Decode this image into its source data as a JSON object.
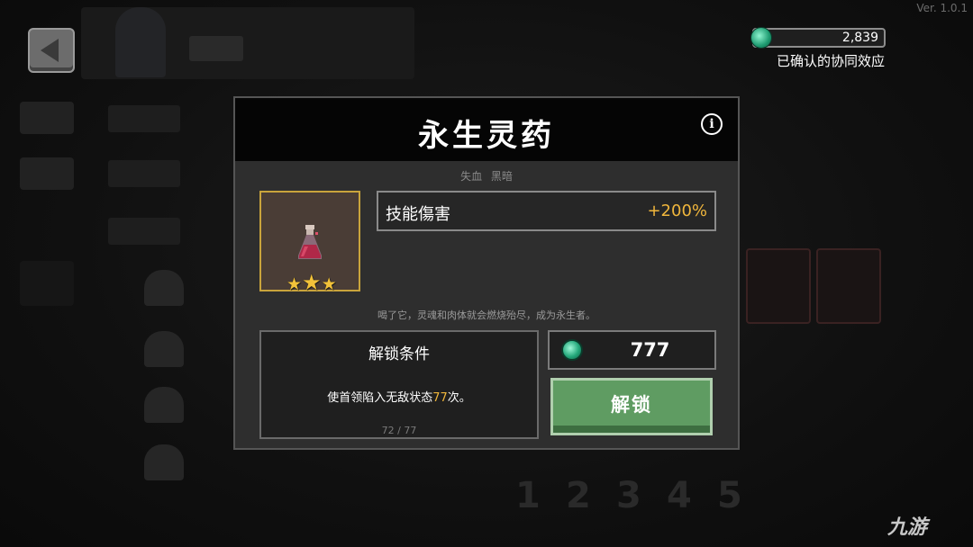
{
  "version": "Ver. 1.0.1",
  "currency": {
    "amount": "2,839",
    "label": "已确认的协同效应",
    "icon": "green-gem-icon"
  },
  "modal": {
    "title": "永生灵药",
    "tags": [
      "失血",
      "黑暗"
    ],
    "stat": {
      "name": "技能傷害",
      "value": "+200%"
    },
    "stars": 3,
    "description": "喝了它，灵魂和肉体就会燃烧殆尽，成为永生者。",
    "unlock_condition": {
      "title": "解锁条件",
      "text_before": "使首领陷入无敌状态",
      "highlight": "77",
      "text_after": "次。",
      "progress": "72 / 77",
      "progress_value": 72,
      "progress_total": 77
    },
    "cost": "777",
    "unlock_button": "解锁"
  },
  "watermark": "九游",
  "colors": {
    "accent_gold": "#f0b63c",
    "unlock_green": "#5f9c62",
    "gem": "#24a87b",
    "item_border": "#c9a43c"
  }
}
